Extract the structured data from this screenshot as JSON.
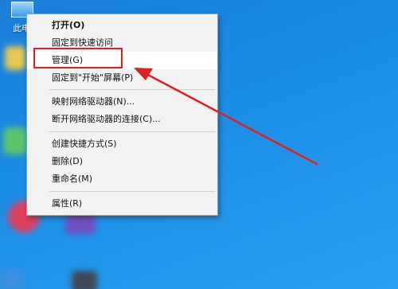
{
  "desktop": {
    "icon_label": "此电"
  },
  "context_menu": {
    "groups": [
      [
        {
          "label": "打开(O)",
          "bold": true
        },
        {
          "label": "固定到快速访问",
          "bold": false
        },
        {
          "label": "管理(G)",
          "bold": false,
          "hover": true
        },
        {
          "label": "固定到\"开始\"屏幕(P)",
          "bold": false
        }
      ],
      [
        {
          "label": "映射网络驱动器(N)...",
          "bold": false
        },
        {
          "label": "断开网络驱动器的连接(C)...",
          "bold": false
        }
      ],
      [
        {
          "label": "创建快捷方式(S)",
          "bold": false
        },
        {
          "label": "删除(D)",
          "bold": false
        },
        {
          "label": "重命名(M)",
          "bold": false
        }
      ],
      [
        {
          "label": "属性(R)",
          "bold": false
        }
      ]
    ]
  },
  "annotation": {
    "highlight_color": "#e02020",
    "arrow_color": "#e02020"
  },
  "colors": {
    "desktop_blue": "#1b8ee6",
    "menu_background": "#f2f2f2",
    "menu_hover": "#ffffff"
  }
}
